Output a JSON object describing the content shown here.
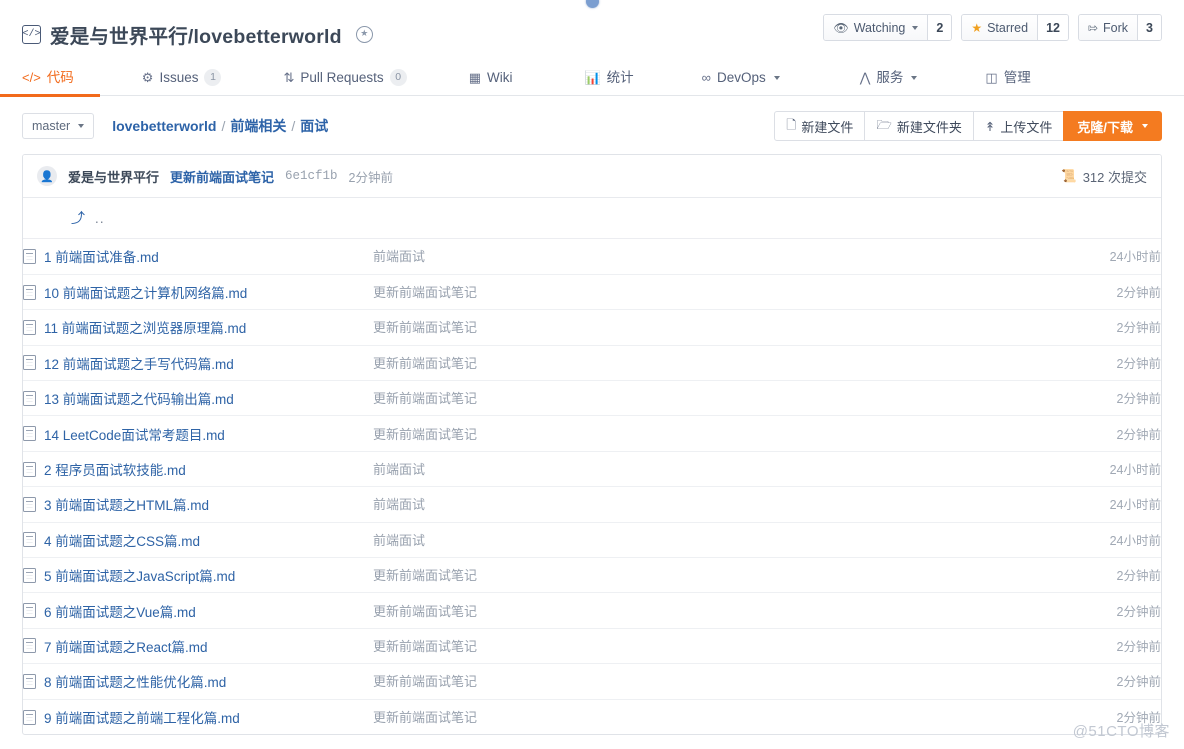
{
  "header": {
    "code_icon": "code-brackets-icon",
    "owner": "爱是与世界平行",
    "slash": "/",
    "repo": "lovebetterworld",
    "badge_icon": "medal-badge-icon",
    "stats": [
      {
        "id": "watching",
        "icon": "eye-icon",
        "label": "Watching",
        "has_caret": true,
        "count": "2"
      },
      {
        "id": "starred",
        "icon": "star-icon",
        "label": "Starred",
        "has_caret": false,
        "count": "12"
      },
      {
        "id": "fork",
        "icon": "fork-icon",
        "label": "Fork",
        "has_caret": false,
        "count": "3"
      }
    ]
  },
  "nav": {
    "tabs": [
      {
        "id": "code",
        "icon": "code-icon",
        "label": "代码",
        "pill": null,
        "active": true,
        "caret": false
      },
      {
        "id": "issues",
        "icon": "issue-icon",
        "label": "Issues",
        "pill": "1",
        "active": false,
        "caret": false
      },
      {
        "id": "pulls",
        "icon": "pr-icon",
        "label": "Pull Requests",
        "pill": "0",
        "active": false,
        "caret": false
      },
      {
        "id": "wiki",
        "icon": "book-icon",
        "label": "Wiki",
        "pill": null,
        "active": false,
        "caret": false
      },
      {
        "id": "stats",
        "icon": "chart-icon",
        "label": "统计",
        "pill": null,
        "active": false,
        "caret": false
      },
      {
        "id": "devops",
        "icon": "infinity-icon",
        "label": "DevOps",
        "pill": null,
        "active": false,
        "caret": true
      },
      {
        "id": "service",
        "icon": "pulse-icon",
        "label": "服务",
        "pill": null,
        "active": false,
        "caret": true
      },
      {
        "id": "manage",
        "icon": "admin-icon",
        "label": "管理",
        "pill": null,
        "active": false,
        "caret": false
      }
    ]
  },
  "toolbar": {
    "branch": "master",
    "breadcrumb": [
      "lovebetterworld",
      "前端相关",
      "面试"
    ],
    "buttons": [
      {
        "id": "new-file",
        "icon": "file-plus-icon",
        "label": "新建文件",
        "primary": false,
        "caret": false
      },
      {
        "id": "new-folder",
        "icon": "folder-plus-icon",
        "label": "新建文件夹",
        "primary": false,
        "caret": false
      },
      {
        "id": "upload",
        "icon": "upload-icon",
        "label": "上传文件",
        "primary": false,
        "caret": false
      },
      {
        "id": "clone",
        "icon": null,
        "label": "克隆/下载",
        "primary": true,
        "caret": true
      }
    ]
  },
  "commit_bar": {
    "avatar_icon": "user-avatar-icon",
    "author": "爱是与世界平行",
    "message": "更新前端面试笔记",
    "sha": "6e1cf1b",
    "time": "2分钟前",
    "commits_icon": "commit-history-icon",
    "commits_label": "312 次提交"
  },
  "parent_row": {
    "arrow_icon": "back-arrow-icon",
    "label": ".."
  },
  "files": [
    {
      "icon": "file-icon",
      "name": "1 前端面试准备.md",
      "message": "前端面试",
      "time": "24小时前"
    },
    {
      "icon": "file-icon",
      "name": "10 前端面试题之计算机网络篇.md",
      "message": "更新前端面试笔记",
      "time": "2分钟前"
    },
    {
      "icon": "file-icon",
      "name": "11 前端面试题之浏览器原理篇.md",
      "message": "更新前端面试笔记",
      "time": "2分钟前"
    },
    {
      "icon": "file-icon",
      "name": "12 前端面试题之手写代码篇.md",
      "message": "更新前端面试笔记",
      "time": "2分钟前"
    },
    {
      "icon": "file-icon",
      "name": "13 前端面试题之代码输出篇.md",
      "message": "更新前端面试笔记",
      "time": "2分钟前"
    },
    {
      "icon": "file-icon",
      "name": "14 LeetCode面试常考题目.md",
      "message": "更新前端面试笔记",
      "time": "2分钟前"
    },
    {
      "icon": "file-icon",
      "name": "2 程序员面试软技能.md",
      "message": "前端面试",
      "time": "24小时前"
    },
    {
      "icon": "file-icon",
      "name": "3 前端面试题之HTML篇.md",
      "message": "前端面试",
      "time": "24小时前"
    },
    {
      "icon": "file-icon",
      "name": "4 前端面试题之CSS篇.md",
      "message": "前端面试",
      "time": "24小时前"
    },
    {
      "icon": "file-icon",
      "name": "5 前端面试题之JavaScript篇.md",
      "message": "更新前端面试笔记",
      "time": "2分钟前"
    },
    {
      "icon": "file-icon",
      "name": "6 前端面试题之Vue篇.md",
      "message": "更新前端面试笔记",
      "time": "2分钟前"
    },
    {
      "icon": "file-icon",
      "name": "7 前端面试题之React篇.md",
      "message": "更新前端面试笔记",
      "time": "2分钟前"
    },
    {
      "icon": "file-icon",
      "name": "8 前端面试题之性能优化篇.md",
      "message": "更新前端面试笔记",
      "time": "2分钟前"
    },
    {
      "icon": "file-icon",
      "name": "9 前端面试题之前端工程化篇.md",
      "message": "更新前端面试笔记",
      "time": "2分钟前"
    }
  ],
  "watermark": "@51CTO博客",
  "colors": {
    "accent_orange": "#f47b20",
    "link_blue": "#2d63a8",
    "muted": "#98a1ae",
    "star_yellow": "#f0a020"
  }
}
